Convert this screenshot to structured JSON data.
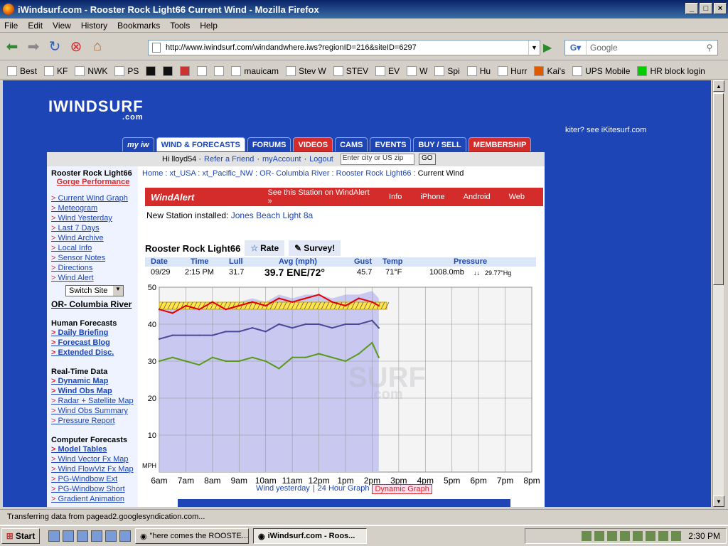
{
  "window": {
    "title": "iWindsurf.com - Rooster Rock Light66 Current Wind - Mozilla Firefox"
  },
  "menu": [
    "File",
    "Edit",
    "View",
    "History",
    "Bookmarks",
    "Tools",
    "Help"
  ],
  "url": "http://www.iwindsurf.com/windandwhere.iws?regionID=216&siteID=6297",
  "search_placeholder": "Google",
  "bookmarks": [
    "Best",
    "KF",
    "NWK",
    "PS",
    "",
    "",
    "",
    "",
    "",
    "mauicam",
    "Stev W",
    "STEV",
    "EV",
    "W",
    "Spi",
    "Hu",
    "Hurr",
    "Kai's",
    "UPS Mobile",
    "HR block login"
  ],
  "site": {
    "logo": "IWINDSURF",
    "logo_sub": ".com",
    "kiter": "kiter? see iKitesurf.com",
    "tabs": [
      "WIND & FORECASTS",
      "FORUMS",
      "VIDEOS",
      "CAMS",
      "EVENTS",
      "BUY / SELL",
      "MEMBERSHIP"
    ],
    "topstrip": {
      "hi": "Hi lloyd54 ·",
      "refer": "Refer a Friend",
      "account": "myAccount",
      "logout": "Logout",
      "city_placeholder": "Enter city or US zip",
      "go": "GO"
    },
    "sidebar": {
      "station": "Rooster Rock Light66",
      "gorge": "Gorge Performance",
      "links1": [
        "Current Wind Graph",
        "Meteogram",
        "Wind Yesterday",
        "Last 7 Days",
        "Wind Archive",
        "Local Info",
        "Sensor Notes",
        "Directions",
        "Wind Alert"
      ],
      "switch": "Switch Site",
      "region": "OR- Columbia River",
      "sec_human": "Human Forecasts",
      "human": [
        "Daily Briefing",
        "Forecast Blog",
        "Extended Disc."
      ],
      "sec_rt": "Real-Time Data",
      "rt_bold": [
        "Dynamic Map",
        "Wind Obs Map"
      ],
      "rt": [
        "Radar + Satellite Map",
        "Wind Obs Summary",
        "Pressure Report"
      ],
      "sec_comp": "Computer Forecasts",
      "comp_bold": [
        "Model Tables"
      ],
      "comp": [
        "Wind Vector Fx Map",
        "Wind FlowViz Fx Map",
        "PG-Windbow Ext",
        "PG-Windbow Short",
        "Gradient Animation"
      ]
    },
    "crumb": {
      "home": "Home",
      "a": "xt_USA",
      "b": "xt_Pacific_NW",
      "c": "OR- Columbia River",
      "d": "Rooster Rock Light66",
      "cur": "Current Wind"
    },
    "windalert": {
      "logo": "WindAlert",
      "see": "See this Station on WindAlert »",
      "info": "Info",
      "iphone": "iPhone",
      "android": "Android",
      "web": "Web"
    },
    "newstation": {
      "label": "New Station installed:",
      "link": "Jones Beach Light 8a"
    },
    "station_title": "Rooster Rock Light66",
    "rate": "Rate",
    "survey": "Survey!",
    "table_headers": [
      "Date",
      "Time",
      "Lull",
      "Avg (mph)",
      "Gust",
      "Temp",
      "Pressure"
    ],
    "table_values": {
      "date": "09/29",
      "time": "2:15 PM",
      "lull": "31.7",
      "avg": "39.7 ENE/72°",
      "gust": "45.7",
      "temp": "71°F",
      "pressure": "1008.0mb",
      "hg": "29.77\"Hg"
    },
    "watermark": "SURF",
    "watermark_sub": ".com",
    "bottom_links": {
      "yesterday": "Wind yesterday",
      "h24": "24 Hour Graph",
      "dynamic": "Dynamic Graph"
    }
  },
  "chart_data": {
    "type": "line",
    "ylabel": "MPH",
    "ylim": [
      0,
      50
    ],
    "yticks": [
      10,
      20,
      30,
      40,
      50
    ],
    "xticks": [
      "6am",
      "7am",
      "8am",
      "9am",
      "10am",
      "11am",
      "12pm",
      "1pm",
      "2pm",
      "3pm",
      "4pm",
      "5pm",
      "6pm",
      "7pm",
      "8pm"
    ],
    "series": [
      {
        "color": "#e60000",
        "x": [
          6,
          6.5,
          7,
          7.5,
          8,
          8.5,
          9,
          9.5,
          10,
          10.5,
          11,
          11.5,
          12,
          12.5,
          13,
          13.5,
          14,
          14.25
        ],
        "values": [
          44,
          43,
          45,
          44,
          46,
          44,
          45,
          46,
          45,
          47,
          46,
          47,
          48,
          46,
          45,
          47,
          46,
          45
        ]
      },
      {
        "color": "#4a4a9a",
        "x": [
          6,
          6.5,
          7,
          7.5,
          8,
          8.5,
          9,
          9.5,
          10,
          10.5,
          11,
          11.5,
          12,
          12.5,
          13,
          13.5,
          14,
          14.25
        ],
        "values": [
          36,
          37,
          37,
          37,
          37,
          38,
          38,
          39,
          38,
          40,
          39,
          40,
          40,
          39,
          40,
          40,
          41,
          39
        ]
      },
      {
        "color": "#5a9a1a",
        "x": [
          6,
          6.5,
          7,
          7.5,
          8,
          8.5,
          9,
          9.5,
          10,
          10.5,
          11,
          11.5,
          12,
          12.5,
          13,
          13.5,
          14,
          14.25
        ],
        "values": [
          30,
          31,
          30,
          29,
          31,
          30,
          30,
          31,
          30,
          28,
          31,
          31,
          32,
          31,
          30,
          32,
          35,
          31
        ]
      }
    ],
    "fill_until": 14.25,
    "direction_band_value": 45,
    "colors": {
      "fill": "#c8c8f0",
      "band": "#ffe44a",
      "grid": "#999999",
      "bg": "#f4f4f4"
    }
  },
  "status": "Transferring data from pagead2.googlesyndication.com...",
  "taskbar": {
    "start": "Start",
    "tasks": [
      "\"here comes the ROOSTE...",
      "iWindsurf.com - Roos..."
    ],
    "clock": "2:30 PM"
  }
}
